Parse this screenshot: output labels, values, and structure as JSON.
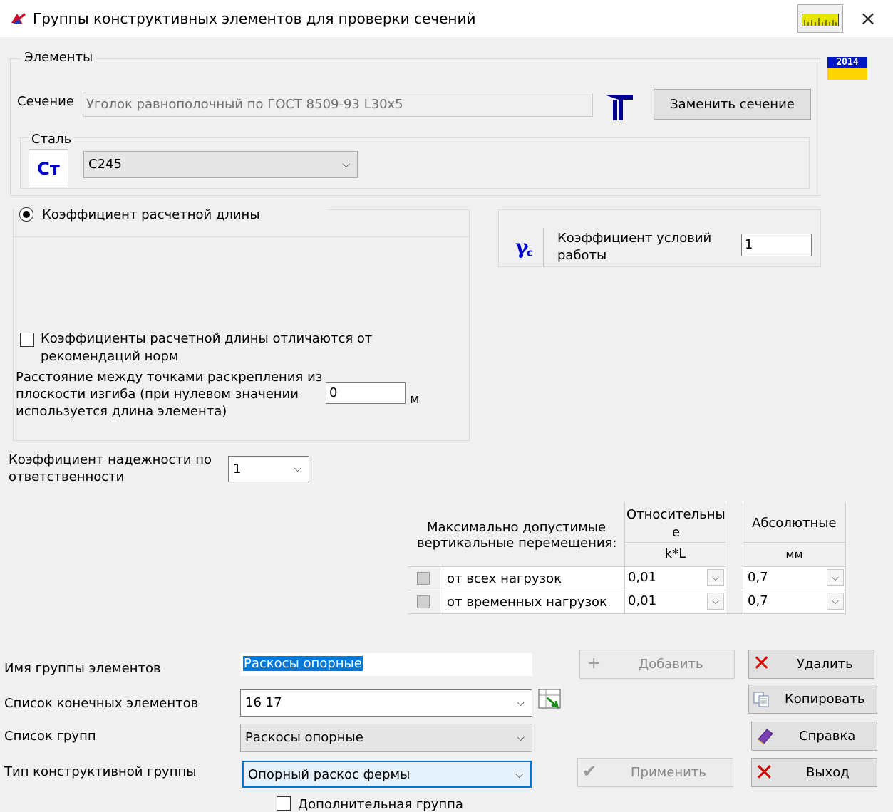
{
  "window": {
    "title": "Группы конструктивных элементов для проверки сечений",
    "close_glyph": "×",
    "badge": "2014"
  },
  "elements_group": {
    "label": "Элементы",
    "section_label": "Сечение",
    "section_value": "Уголок равнополочный по ГОСТ 8509-93 L30x5",
    "replace_button": "Заменить сечение",
    "steel_group_label": "Сталь",
    "steel_icon_text": "Ст",
    "steel_value": "С245"
  },
  "length_group": {
    "radio_label": "Коэффициент расчетной длины",
    "checkbox_label_line1": "Коэффициенты расчетной длины отличаются от",
    "checkbox_label_line2": "рекомендаций норм",
    "distance_line1": "Расстояние между точками раскрепления из",
    "distance_line2": "плоскости изгиба (при нулевом значении",
    "distance_line3": "используется длина элемента)",
    "distance_value": "0",
    "distance_unit": "м"
  },
  "work_conditions": {
    "icon_text": "γ",
    "icon_sub": "c",
    "label_line1": "Коэффициент условий",
    "label_line2": "работы",
    "value": "1"
  },
  "reliability": {
    "label_line1": "Коэффициент надежности по",
    "label_line2": "ответственности",
    "value": "1"
  },
  "displacements": {
    "header_line1": "Максимально допустимые",
    "header_line2": "вертикальные перемещения:",
    "col_rel_line1": "Относительны",
    "col_rel_line2": "е",
    "col_rel_unit": "k*L",
    "col_abs": "Абсолютные",
    "col_abs_unit": "мм",
    "rows": [
      {
        "label": "от всех нагрузок",
        "rel": "0,01",
        "abs": "0,7"
      },
      {
        "label": "от временных нагрузок",
        "rel": "0,01",
        "abs": "0,7"
      }
    ]
  },
  "group_form": {
    "name_label": "Имя группы элементов",
    "name_value": "Раскосы опорные",
    "list_label": "Список конечных элементов",
    "list_value": "16 17",
    "groups_label": "Список групп",
    "groups_value": "Раскосы опорные",
    "type_label": "Тип конструктивной группы",
    "type_value": "Опорный раскос фермы",
    "extra_label": "Дополнительная группа"
  },
  "buttons": {
    "add": "Добавить",
    "delete": "Удалить",
    "copy": "Копировать",
    "help": "Справка",
    "apply": "Применить",
    "exit": "Выход"
  },
  "colors": {
    "accent": "#0000cc",
    "selection": "#0078d7",
    "delete_red": "#e00000"
  }
}
